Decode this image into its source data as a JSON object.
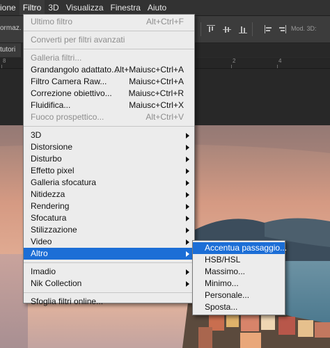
{
  "menubar": {
    "items": [
      {
        "label": "ione"
      },
      {
        "label": "Filtro"
      },
      {
        "label": "3D"
      },
      {
        "label": "Visualizza"
      },
      {
        "label": "Finestra"
      },
      {
        "label": "Aiuto"
      }
    ]
  },
  "options_bar": {
    "left_label": "ormaz.",
    "mode_label": "Mod. 3D:"
  },
  "doc_tab": {
    "label": "tutori"
  },
  "ruler": {
    "ticks": [
      "8",
      "6",
      "4",
      "2",
      "0",
      "2",
      "4"
    ]
  },
  "filter_menu": {
    "items": [
      {
        "label": "Ultimo filtro",
        "shortcut": "Alt+Ctrl+F",
        "disabled": true
      },
      {
        "label": "Converti per filtri avanzati",
        "shortcut": "",
        "disabled": false
      },
      {
        "label": "Galleria filtri...",
        "shortcut": "",
        "disabled": true
      },
      {
        "label": "Grandangolo adattato...",
        "shortcut": "Alt+Maiusc+Ctrl+A",
        "disabled": false
      },
      {
        "label": "Filtro Camera Raw...",
        "shortcut": "Maiusc+Ctrl+A",
        "disabled": false
      },
      {
        "label": "Correzione obiettivo...",
        "shortcut": "Maiusc+Ctrl+R",
        "disabled": false
      },
      {
        "label": "Fluidifica...",
        "shortcut": "Maiusc+Ctrl+X",
        "disabled": false
      },
      {
        "label": "Fuoco prospettico...",
        "shortcut": "Alt+Ctrl+V",
        "disabled": true
      },
      {
        "label": "3D"
      },
      {
        "label": "Distorsione"
      },
      {
        "label": "Disturbo"
      },
      {
        "label": "Effetto pixel"
      },
      {
        "label": "Galleria sfocatura"
      },
      {
        "label": "Nitidezza"
      },
      {
        "label": "Rendering"
      },
      {
        "label": "Sfocatura"
      },
      {
        "label": "Stilizzazione"
      },
      {
        "label": "Video"
      },
      {
        "label": "Altro",
        "highlighted": true
      },
      {
        "label": "Imadio"
      },
      {
        "label": "Nik Collection"
      },
      {
        "label": "Sfoglia filtri online..."
      }
    ]
  },
  "altro_submenu": {
    "items": [
      {
        "label": "Accentua passaggio...",
        "highlighted": true
      },
      {
        "label": "HSB/HSL"
      },
      {
        "label": "Massimo..."
      },
      {
        "label": "Minimo..."
      },
      {
        "label": "Personale..."
      },
      {
        "label": "Sposta..."
      }
    ]
  },
  "colors": {
    "menu_bg": "#ececec",
    "highlight": "#1c6ed6",
    "app_bg": "#2b2b2b"
  }
}
